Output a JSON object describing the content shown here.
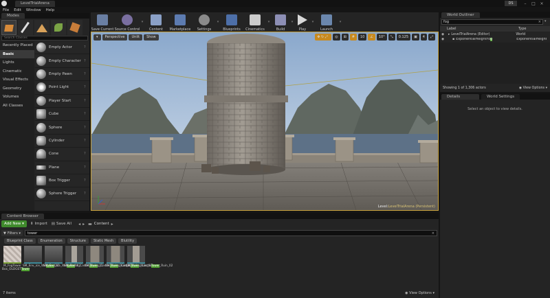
{
  "window": {
    "tab_title": "LevelTrialArena",
    "profile": "DS"
  },
  "menu": [
    "File",
    "Edit",
    "Window",
    "Help"
  ],
  "modes": {
    "tab": "Modes",
    "search_placeholder": "Search Classes",
    "categories": [
      "Recently Placed",
      "Basic",
      "Lights",
      "Cinematic",
      "Visual Effects",
      "Geometry",
      "Volumes",
      "All Classes"
    ],
    "active_category": "Basic",
    "items": [
      "Empty Actor",
      "Empty Character",
      "Empty Pawn",
      "Point Light",
      "Player Start",
      "Cube",
      "Sphere",
      "Cylinder",
      "Cone",
      "Plane",
      "Box Trigger",
      "Sphere Trigger"
    ]
  },
  "toolbar": {
    "buttons": [
      "Save Current",
      "Source Control",
      "Content",
      "Marketplace",
      "Settings",
      "Blueprints",
      "Cinematics",
      "Build",
      "Play",
      "Launch"
    ]
  },
  "viewport": {
    "perspective": "Perspective",
    "unlit": "Unlit",
    "show": "Show",
    "grid_value": "10",
    "rotation_value": "10°",
    "scale_value": "0.125",
    "camera_speed": "4",
    "level_label": "Level: ",
    "level_name": "LevelTrialArena (Persistent)"
  },
  "outliner": {
    "tab": "World Outliner",
    "search_value": "fog",
    "col_label": "Label",
    "col_type": "Type",
    "rows": [
      {
        "label": "LevelTrialArena (Editor)",
        "type": "World"
      },
      {
        "label_pre": "ExponentialHeightFo",
        "label_hl": "g",
        "type": "ExponentialHeight"
      }
    ],
    "status": "Showing 1 of 1,306 actors",
    "view_options": "View Options"
  },
  "details": {
    "tab": "Details",
    "tab2": "World Settings",
    "empty_text": "Select an object to view details."
  },
  "content_browser": {
    "tab": "Content Browser",
    "add_new": "Add New",
    "import": "Import",
    "save_all": "Save All",
    "path": "Content",
    "filters": "Filters",
    "search_value": "tower",
    "chips": [
      "Blueprint Class",
      "Enumeration",
      "Structure",
      "Static Mesh",
      "Blutility"
    ],
    "assets": [
      {
        "pre": "M_FogTower Box_OLDGST",
        "hl": "Tower",
        "post": ""
      },
      {
        "pre": "SM_Env_ice_We",
        "hl": "tower",
        "post": "001"
      },
      {
        "pre": "SM_Env_ice_We",
        "hl": "tower",
        "post": "002"
      },
      {
        "pre": "SM_Plains_Castle",
        "hl": "Tower",
        "post": "_01"
      },
      {
        "pre": "SM_Plains_Castle",
        "hl": "Tower",
        "post": "_Ruin_01"
      },
      {
        "pre": "SM_Plains_Castle",
        "hl": "Tower",
        "post": "_Ruin_02"
      },
      {
        "pre": "SM_Plains_Castle",
        "hl": "Tower",
        "post": "_Ruin_02"
      }
    ],
    "item_count": "7 items",
    "view_options": "View Options"
  }
}
